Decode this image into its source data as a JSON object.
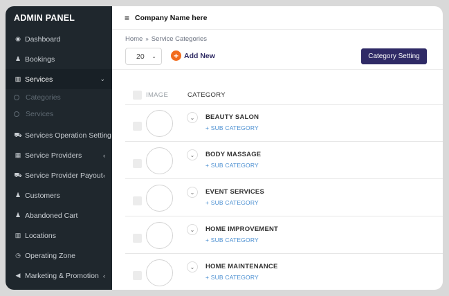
{
  "sidebar": {
    "brand": "ADMIN PANEL",
    "items": [
      {
        "label": "Dashboard",
        "icon": "dashboard-icon",
        "glyph": "◉"
      },
      {
        "label": "Bookings",
        "icon": "user-tie-icon",
        "glyph": "♟"
      },
      {
        "label": "Services",
        "icon": "bank-icon",
        "glyph": "▥",
        "chevron": "⌄"
      },
      {
        "label": "Services Operation Setting",
        "icon": "cart-icon",
        "glyph": "⛟",
        "chevron": "‹"
      },
      {
        "label": "Service Providers",
        "icon": "grid-icon",
        "glyph": "▦",
        "chevron": "‹"
      },
      {
        "label": "Service Provider Payout",
        "icon": "cart-icon",
        "glyph": "⛟",
        "chevron": "‹"
      },
      {
        "label": "Customers",
        "icon": "users-icon",
        "glyph": "♟"
      },
      {
        "label": "Abandoned Cart",
        "icon": "user-tie-icon",
        "glyph": "♟"
      },
      {
        "label": "Locations",
        "icon": "table-icon",
        "glyph": "▥"
      },
      {
        "label": "Operating Zone",
        "icon": "clock-icon",
        "glyph": "◷"
      },
      {
        "label": "Marketing & Promotion",
        "icon": "megaphone-icon",
        "glyph": "◀",
        "chevron": "‹"
      }
    ],
    "sub_items": [
      {
        "label": "Categories"
      },
      {
        "label": "Services"
      }
    ]
  },
  "topbar": {
    "menu_glyph": "≡",
    "company": "Company Name here"
  },
  "breadcrumb": {
    "home": "Home",
    "separator": "»",
    "current": "Service Categories"
  },
  "toolbar": {
    "page_size": "20",
    "add_new": "Add New",
    "category_setting": "Category Setting"
  },
  "table": {
    "columns": [
      "IMAGE",
      "CATEGORY"
    ],
    "rows": [
      {
        "name": "BEAUTY SALON",
        "sub": "+ SUB CATEGORY"
      },
      {
        "name": "BODY MASSAGE",
        "sub": "+ SUB CATEGORY"
      },
      {
        "name": "EVENT SERVICES",
        "sub": "+ SUB CATEGORY"
      },
      {
        "name": "HOME IMPROVEMENT",
        "sub": "+ SUB CATEGORY"
      },
      {
        "name": "HOME MAINTENANCE",
        "sub": "+ SUB CATEGORY"
      }
    ]
  },
  "colors": {
    "sidebar_bg": "#1f272d",
    "accent_button": "#2f2a66",
    "add_icon": "#f26b1d",
    "link": "#4b8fd1"
  }
}
